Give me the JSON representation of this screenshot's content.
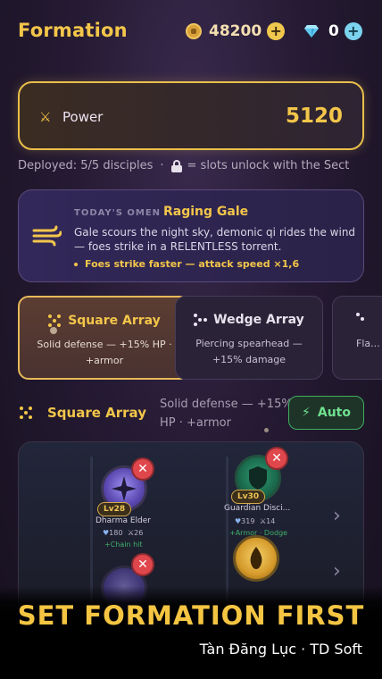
{
  "header": {
    "title": "Formation",
    "coins": "48200",
    "gems": "0"
  },
  "power": {
    "label": "Power",
    "value": "5120"
  },
  "deployed": {
    "text": "Deployed: 5/5 disciples",
    "sep": "·",
    "lock_text": "= slots unlock with the Sect"
  },
  "omen": {
    "tag": "TODAY'S OMEN",
    "name": "Raging Gale",
    "description": "Gale scours the night sky, demonic qi rides the wind — foes strike in a RELENTLESS torrent.",
    "effect": "Foes strike faster — attack speed ×1,6"
  },
  "formations": [
    {
      "name": "Square Array",
      "desc": "Solid defense — +15% HP · +armor",
      "selected": true
    },
    {
      "name": "Wedge Array",
      "desc": "Piercing spearhead — +15% damage",
      "selected": false
    },
    {
      "name": "",
      "desc": "Fla... +",
      "selected": false
    }
  ],
  "selected_formation": {
    "name": "Square Array",
    "desc": "Solid defense — +15% HP · +armor",
    "auto_label": "Auto"
  },
  "board": {
    "slots": [
      {
        "name": "Dharma Elder",
        "level": "Lv28",
        "hp": "180",
        "atk": "26",
        "bonus": "+Chain hit",
        "icon": "star-icon",
        "color": "purple"
      },
      {
        "name": "Guardian Disci...",
        "level": "Lv30",
        "hp": "319",
        "atk": "14",
        "bonus": "+Armor · Dodge",
        "icon": "shield-icon",
        "color": "green"
      }
    ]
  },
  "banner": {
    "headline": "SET FORMATION FIRST",
    "credit": "Tàn Đăng Lục · TD Soft"
  },
  "colors": {
    "accent": "#f3c64a",
    "auto": "#3fae5e",
    "remove": "#e0474c"
  }
}
